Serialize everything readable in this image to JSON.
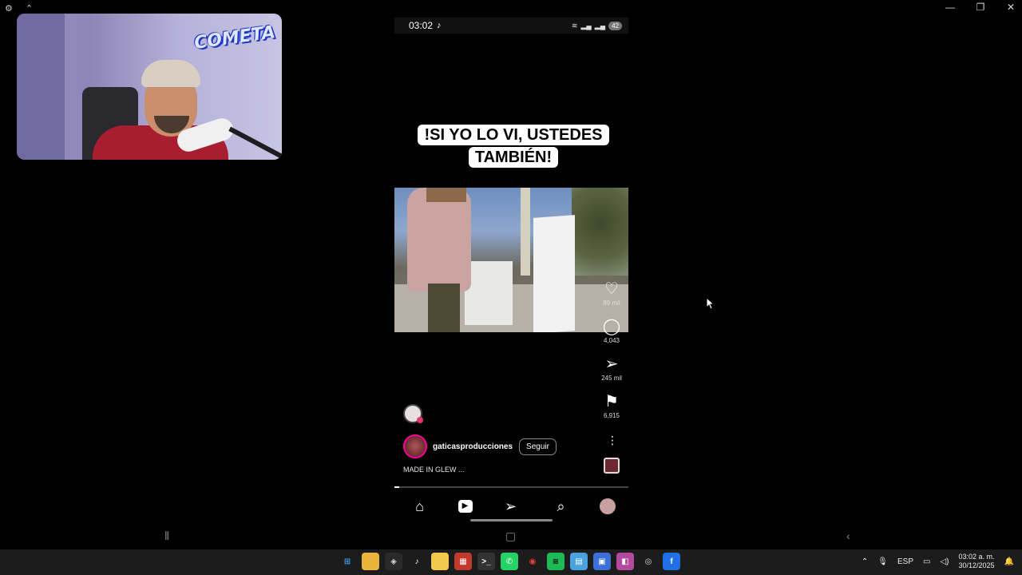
{
  "window": {
    "left_icons": [
      "settings-icon",
      "pin-icon"
    ],
    "controls": [
      {
        "name": "minimize-button",
        "glyph": "—"
      },
      {
        "name": "restore-button",
        "glyph": "❐"
      },
      {
        "name": "close-button",
        "glyph": "✕"
      }
    ]
  },
  "webcam": {
    "logo_text": "COMETA"
  },
  "phone": {
    "status": {
      "time": "03:02",
      "battery": "42"
    },
    "caption": "!SI YO LO VI, USTEDES TAMBIÉN!",
    "actions": {
      "likes": "89 mil",
      "comments": "4,043",
      "shares": "245 mil",
      "saves": "6,915"
    },
    "author": {
      "username": "gaticasproducciones",
      "follow_label": "Seguir"
    },
    "description": "MADE IN GLEW ...",
    "progress": 0.02
  },
  "taskbar": {
    "apps": [
      {
        "name": "windows-start-icon",
        "glyph": "⊞",
        "bg": "#1c1c1c",
        "color": "#3aa0ff"
      },
      {
        "name": "file-explorer-icon",
        "glyph": "▬",
        "bg": "#e8b43a",
        "color": "#e8b43a"
      },
      {
        "name": "store-icon",
        "glyph": "◈",
        "bg": "#2a2a2a",
        "color": "#ddd"
      },
      {
        "name": "tiktok-icon",
        "glyph": "♪",
        "bg": "#1c1c1c",
        "color": "#fff"
      },
      {
        "name": "sticky-notes-icon",
        "glyph": "▰",
        "bg": "#f2c94c",
        "color": "#f2c94c"
      },
      {
        "name": "voicemod-icon",
        "glyph": "▦",
        "bg": "#c0392b",
        "color": "#fff"
      },
      {
        "name": "terminal-icon",
        "glyph": ">_",
        "bg": "#333",
        "color": "#fff"
      },
      {
        "name": "whatsapp-icon",
        "glyph": "✆",
        "bg": "#25d366",
        "color": "#fff"
      },
      {
        "name": "chrome-icon",
        "glyph": "◉",
        "bg": "#1c1c1c",
        "color": "#e94235"
      },
      {
        "name": "spotify-icon",
        "glyph": "≋",
        "bg": "#1db954",
        "color": "#000"
      },
      {
        "name": "app-icon-1",
        "glyph": "▤",
        "bg": "#4aa3df",
        "color": "#fff"
      },
      {
        "name": "app-icon-2",
        "glyph": "▣",
        "bg": "#3d6fd8",
        "color": "#fff"
      },
      {
        "name": "app-icon-3",
        "glyph": "◧",
        "bg": "#b44aa0",
        "color": "#fff"
      },
      {
        "name": "obs-icon",
        "glyph": "◎",
        "bg": "#1c1c1c",
        "color": "#ddd"
      },
      {
        "name": "scrcpy-icon",
        "glyph": "f",
        "bg": "#1f6fe5",
        "color": "#fff"
      }
    ],
    "tray": {
      "language": "ESP",
      "time": "03:02 a. m.",
      "date": "30/12/2025"
    }
  }
}
